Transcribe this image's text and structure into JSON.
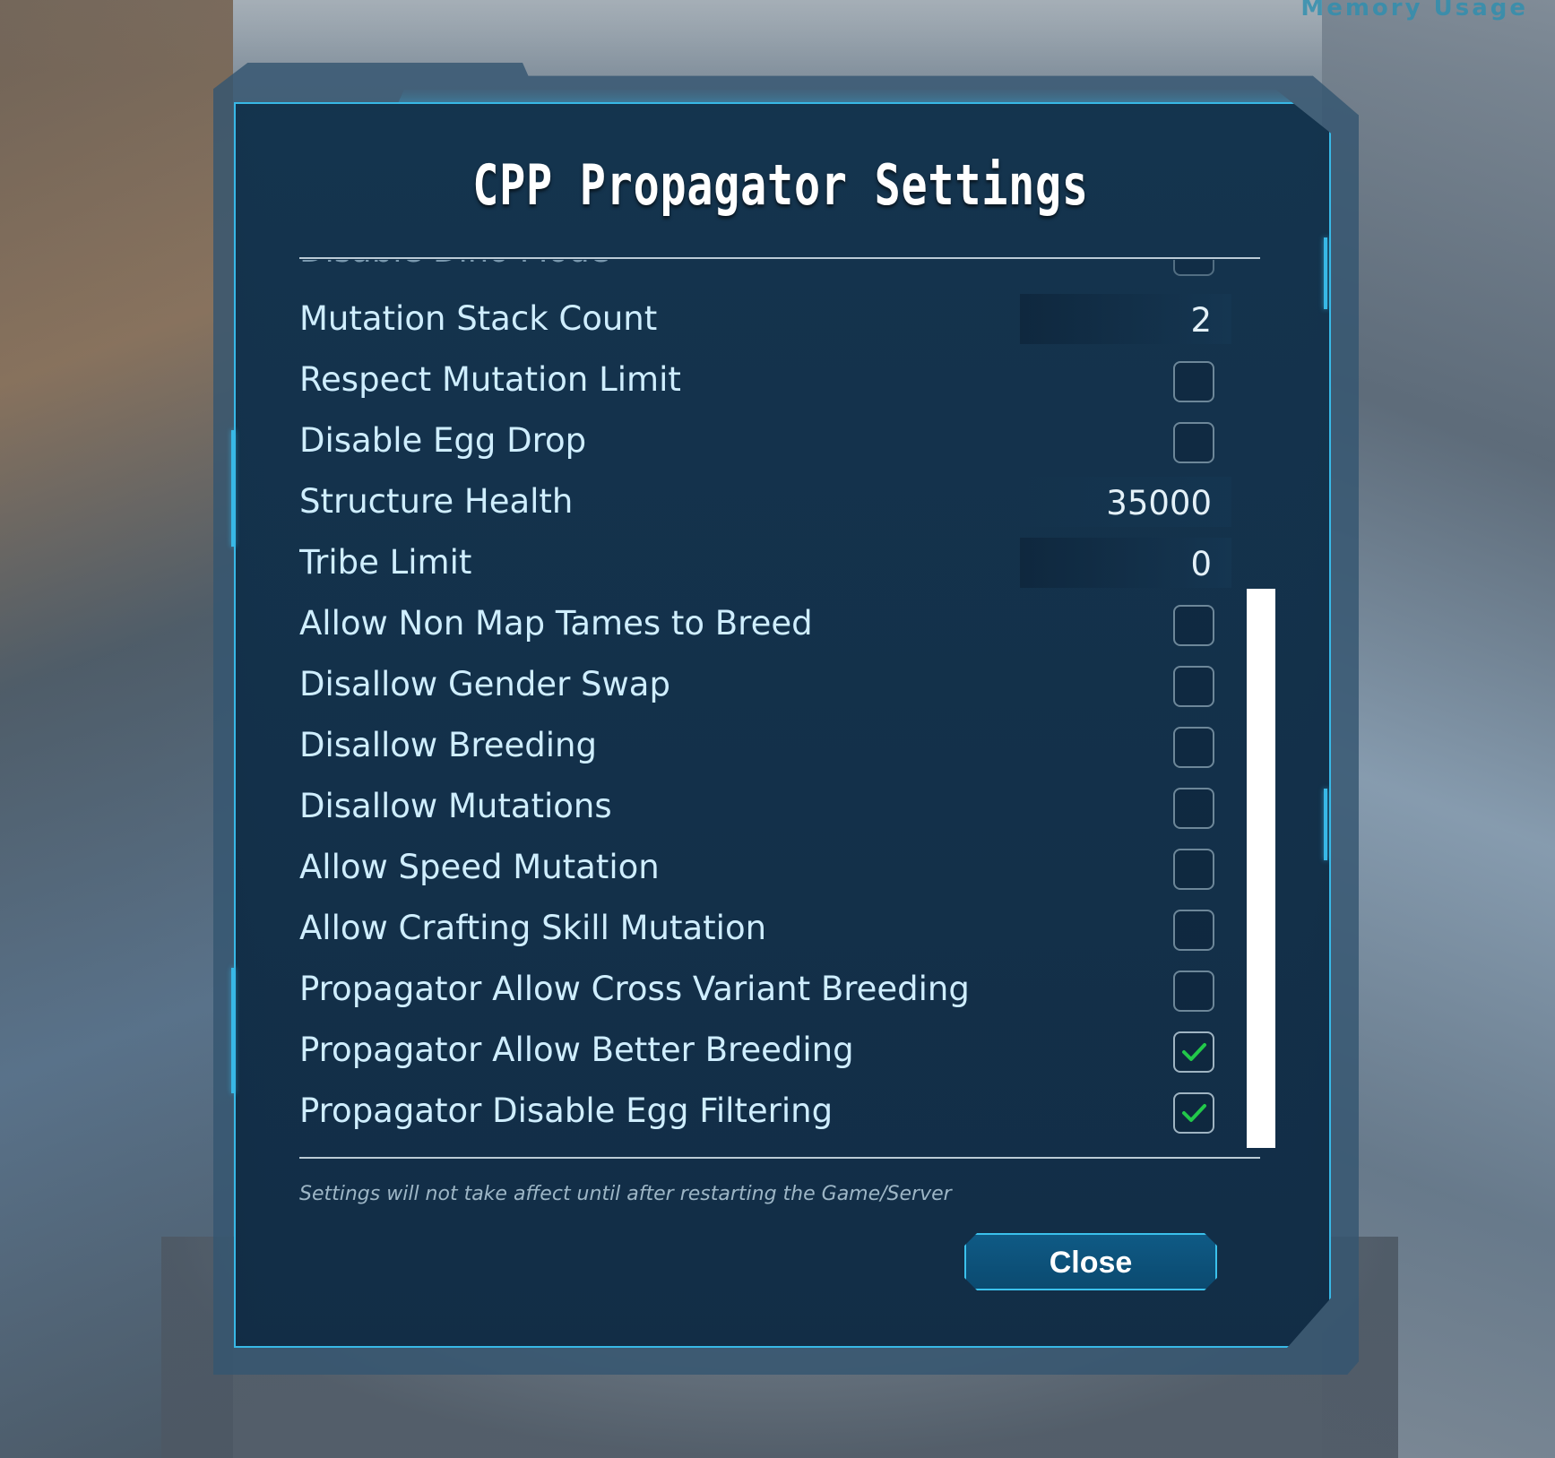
{
  "background": {
    "corner_text": "Memory Usage"
  },
  "dialog": {
    "title": "CPP Propagator Settings",
    "partial_row_label": "Disable Dino Mode",
    "rows": [
      {
        "label": "Mutation Stack Count",
        "type": "number",
        "value": "2"
      },
      {
        "label": "Respect Mutation Limit",
        "type": "checkbox",
        "checked": false
      },
      {
        "label": "Disable Egg Drop",
        "type": "checkbox",
        "checked": false
      },
      {
        "label": "Structure Health",
        "type": "number",
        "value": "35000"
      },
      {
        "label": "Tribe Limit",
        "type": "number",
        "value": "0"
      },
      {
        "label": "Allow Non Map Tames to Breed",
        "type": "checkbox",
        "checked": false
      },
      {
        "label": "Disallow Gender Swap",
        "type": "checkbox",
        "checked": false
      },
      {
        "label": "Disallow Breeding",
        "type": "checkbox",
        "checked": false
      },
      {
        "label": "Disallow Mutations",
        "type": "checkbox",
        "checked": false
      },
      {
        "label": "Allow Speed Mutation",
        "type": "checkbox",
        "checked": false
      },
      {
        "label": "Allow Crafting Skill Mutation",
        "type": "checkbox",
        "checked": false
      },
      {
        "label": "Propagator Allow Cross Variant Breeding",
        "type": "checkbox",
        "checked": false
      },
      {
        "label": "Propagator Allow Better Breeding",
        "type": "checkbox",
        "checked": true
      },
      {
        "label": "Propagator Disable Egg Filtering",
        "type": "checkbox",
        "checked": true
      }
    ],
    "footnote": "Settings will not take affect until after restarting the Game/Server",
    "close_label": "Close"
  },
  "colors": {
    "accent": "#38b8e6",
    "checkmark": "#22c84a",
    "label": "#cfeeff",
    "panel": "#15324b"
  }
}
